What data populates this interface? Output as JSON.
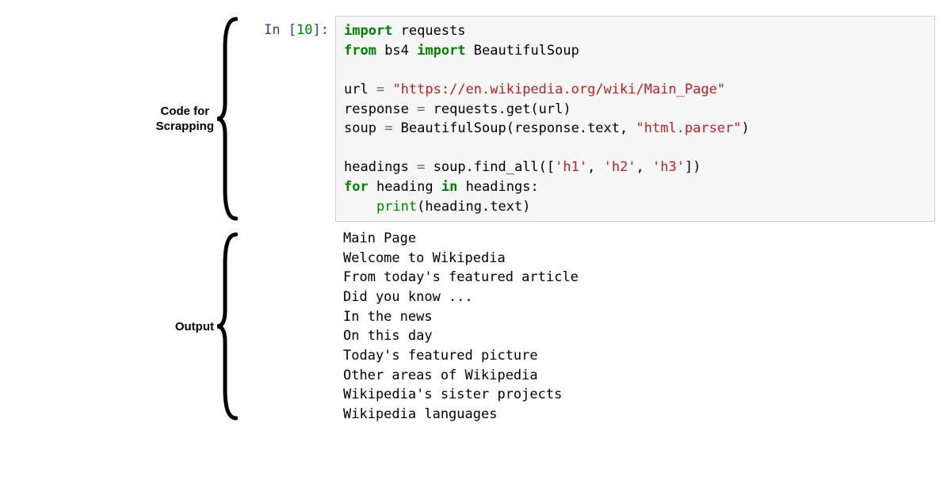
{
  "labels": {
    "code_label_line1": "Code for",
    "code_label_line2": "Scrapping",
    "output_label": "Output"
  },
  "prompt": {
    "in_open": "In [",
    "in_num": "10",
    "in_close": "]:"
  },
  "code": {
    "l1_import": "import",
    "l1_requests": " requests",
    "l2_from": "from",
    "l2_bs4": " bs4 ",
    "l2_import": "import",
    "l2_bs": " BeautifulSoup",
    "l4_url": "url ",
    "l4_eq": "=",
    "l4_str": " \"https://en.wikipedia.org/wiki/Main_Page\"",
    "l5_resp": "response ",
    "l5_eq": "=",
    "l5_call": " requests.get(url)",
    "l6_soup": "soup ",
    "l6_eq": "=",
    "l6_bs": " BeautifulSoup(response.text, ",
    "l6_parser": "\"html.parser\"",
    "l6_close": ")",
    "l8_head": "headings ",
    "l8_eq": "=",
    "l8_call1": " soup.find_all([",
    "l8_h1": "'h1'",
    "l8_c1": ", ",
    "l8_h2": "'h2'",
    "l8_c2": ", ",
    "l8_h3": "'h3'",
    "l8_close": "])",
    "l9_for": "for",
    "l9_mid": " heading ",
    "l9_in": "in",
    "l9_end": " headings:",
    "l10_indent": "    ",
    "l10_print": "print",
    "l10_call": "(heading.text)"
  },
  "output_lines": [
    "Main Page",
    "Welcome to Wikipedia",
    "From today's featured article",
    "Did you know ...",
    "In the news",
    "On this day",
    "Today's featured picture",
    "Other areas of Wikipedia",
    "Wikipedia's sister projects",
    "Wikipedia languages"
  ]
}
